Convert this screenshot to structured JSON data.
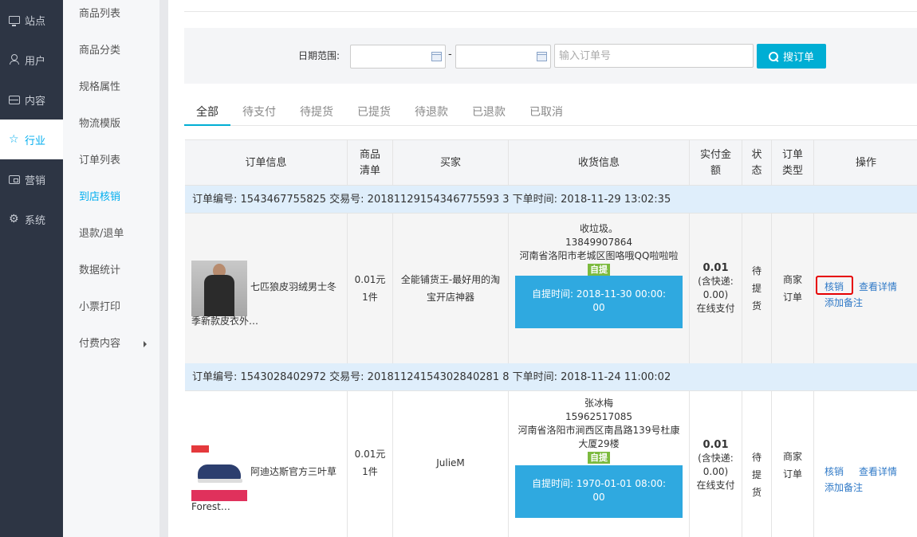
{
  "nav": {
    "items": [
      {
        "label": "站点",
        "icon": "monitor-icon"
      },
      {
        "label": "用户",
        "icon": "user-icon"
      },
      {
        "label": "内容",
        "icon": "inbox-icon"
      },
      {
        "label": "行业",
        "icon": "star-icon",
        "active": true
      },
      {
        "label": "营销",
        "icon": "wallet-icon"
      },
      {
        "label": "系统",
        "icon": "gear-icon"
      }
    ]
  },
  "submenu": {
    "items": [
      "商品列表",
      "商品分类",
      "规格属性",
      "物流模版",
      "订单列表",
      "到店核销",
      "退款/退单",
      "数据统计",
      "小票打印",
      "付费内容"
    ],
    "active": "到店核销"
  },
  "filter": {
    "date_label": "日期范围:",
    "dash": "-",
    "order_placeholder": "输入订单号",
    "search_label": "搜订单"
  },
  "tabs": [
    "全部",
    "待支付",
    "待提货",
    "已提货",
    "待退款",
    "已退款",
    "已取消"
  ],
  "table": {
    "headers": {
      "order_info": "订单信息",
      "goods_1": "商品",
      "goods_2": "清单",
      "buyer": "买家",
      "shipping": "收货信息",
      "paid_1": "实付金",
      "paid_2": "额",
      "status_1": "状",
      "status_2": "态",
      "type_1": "订单",
      "type_2": "类型",
      "ops": "操作"
    },
    "orders": [
      {
        "header": "订单编号: 1543467755825 交易号: 20181129154346775593 3 下单时间: 2018-11-29 13:02:35",
        "product_line1": "七匹狼皮羽绒男士冬",
        "product_line2": "季新款皮衣外…",
        "price": "0.01元",
        "qty": "1件",
        "buyer_line1": "全能铺货王-最好用的淘",
        "buyer_line2": "宝开店神器",
        "recv_name": "收垃圾。",
        "recv_phone": "13849907864",
        "recv_addr": "河南省洛阳市老城区图咯哦QQ啦啦啦",
        "selfpick": "自提",
        "pick_time_line1": "自提时间: 2018-11-30 00:00:",
        "pick_time_line2": "00",
        "amount": "0.01",
        "shipping_note_1": "(含快递:",
        "shipping_note_2": "0.00)",
        "pay_method": "在线支付",
        "status_1": "待",
        "status_2": "提",
        "status_3": "货",
        "type_1": "商家",
        "type_2": "订单",
        "op_verify": "核销",
        "op_detail": "查看详情",
        "op_note": "添加备注"
      },
      {
        "header": "订单编号: 1543028402972 交易号: 20181124154302840281 8 下单时间: 2018-11-24 11:00:02",
        "product_line1": "阿迪达斯官方三叶草",
        "product_line2": "Forest…",
        "price": "0.01元",
        "qty": "1件",
        "buyer_line1": "JulieM",
        "recv_name": "张冰梅",
        "recv_phone": "15962517085",
        "recv_addr_1": "河南省洛阳市涧西区南昌路139号杜康",
        "recv_addr_2": "大厦29楼",
        "selfpick": "自提",
        "pick_time_line1": "自提时间: 1970-01-01 08:00:",
        "pick_time_line2": "00",
        "amount": "0.01",
        "shipping_note_1": "(含快递:",
        "shipping_note_2": "0.00)",
        "pay_method": "在线支付",
        "status_1": "待",
        "status_2": "提",
        "status_3": "货",
        "type_1": "商家",
        "type_2": "订单",
        "op_verify": "核销",
        "op_detail": "查看详情",
        "op_note": "添加备注"
      }
    ]
  },
  "colors": {
    "accent": "#00aed4",
    "nav_bg": "#2d3544",
    "selfpick": "#7cba3e",
    "pickbox": "#2fa9e0",
    "link": "#2f79c7",
    "highlight": "#e60000"
  }
}
